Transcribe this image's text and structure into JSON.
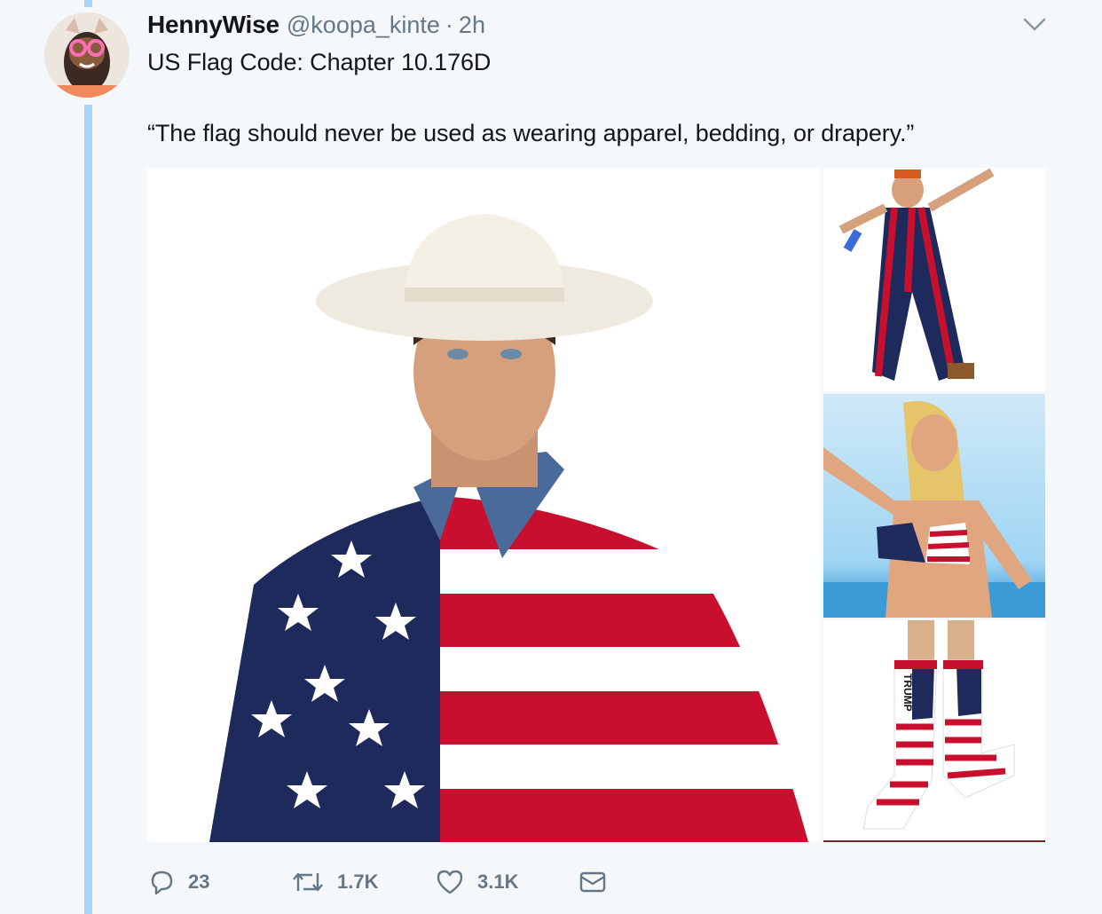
{
  "tweet": {
    "display_name": "HennyWise",
    "handle": "@koopa_kinte",
    "separator": "·",
    "time": "2h",
    "text_line1": "US Flag Code: Chapter 10.176D",
    "text_line2": "“The flag should never be used as wearing apparel, bedding, or drapery.”"
  },
  "media": {
    "images": [
      {
        "depicts": "man-cowboy-hat-flag-shirt"
      },
      {
        "depicts": "man-flag-overalls"
      },
      {
        "depicts": "woman-flag-bikini"
      },
      {
        "depicts": "flag-socks",
        "label": "TRUMP"
      }
    ]
  },
  "actions": {
    "replies": "23",
    "retweets": "1.7K",
    "likes": "3.1K"
  },
  "colors": {
    "background": "#f5f8fa",
    "thread_line": "#a6d5f8",
    "secondary_text": "#657786",
    "flag_red": "#c8102e",
    "flag_blue": "#1f2a5c"
  }
}
